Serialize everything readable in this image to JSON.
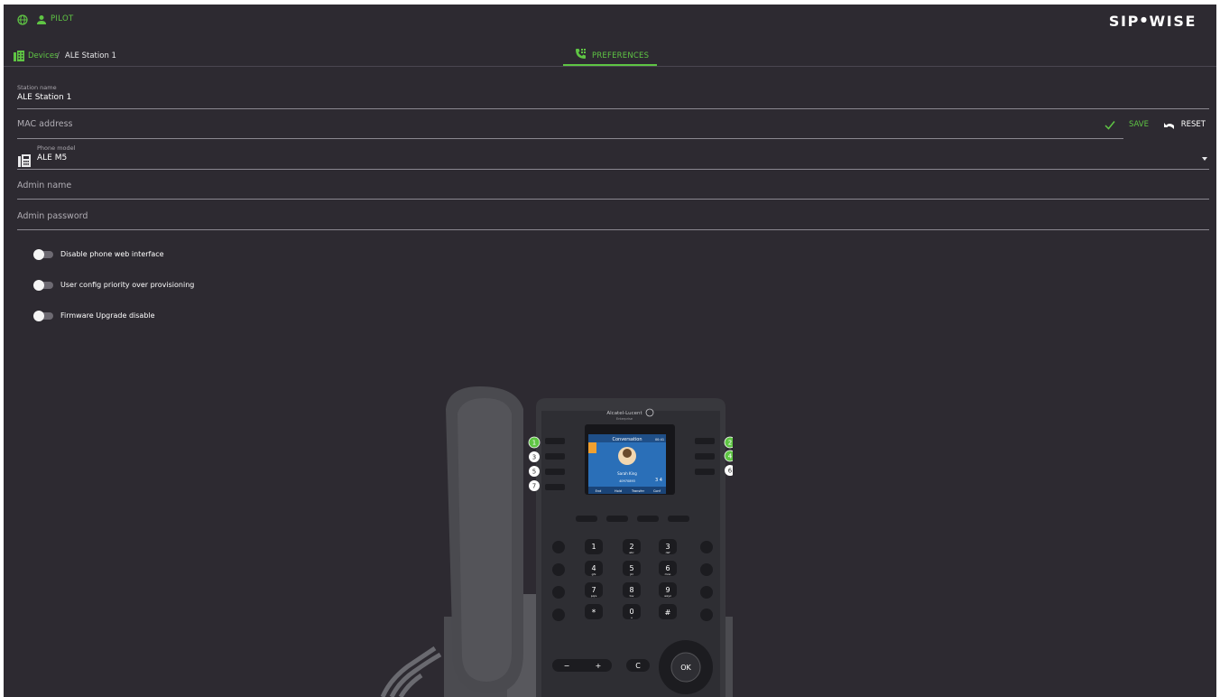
{
  "header": {
    "user_name": "PILOT",
    "logo_text_left": "SIP",
    "logo_text_right": "WISE",
    "logo_dot": "●"
  },
  "breadcrumb": {
    "link": "Devices",
    "separator": "/",
    "current": "ALE Station 1"
  },
  "tabs": [
    {
      "label": "PREFERENCES",
      "active": true
    }
  ],
  "form": {
    "station_name": {
      "label": "Station name",
      "value": "ALE Station 1"
    },
    "mac_address": {
      "placeholder": "MAC address"
    },
    "phone_model": {
      "label": "Phone model",
      "value": "ALE M5"
    },
    "admin_name": {
      "placeholder": "Admin name"
    },
    "admin_password": {
      "placeholder": "Admin password"
    }
  },
  "actions": {
    "save_label": "SAVE",
    "reset_label": "RESET"
  },
  "toggles": [
    {
      "label": "Disable phone web interface",
      "on": false
    },
    {
      "label": "User config priority over provisioning",
      "on": false
    },
    {
      "label": "Firmware Upgrade disable",
      "on": false
    }
  ],
  "phone_image": {
    "brand": "Alcatel-Lucent",
    "brand_sub": "Enterprise",
    "screen_title": "Conversation",
    "screen_time": "00:41",
    "contact_name": "Sarah King",
    "contact_number": "40970893",
    "page_indicator": "3 4",
    "softkeys": [
      "End",
      "Hold",
      "Transfer",
      "Conf"
    ],
    "line_key_numbers": [
      "1",
      "2",
      "3",
      "4",
      "5",
      "6",
      "7"
    ],
    "keypad": [
      {
        "digit": "1",
        "letters": ""
      },
      {
        "digit": "2",
        "letters": "abc"
      },
      {
        "digit": "3",
        "letters": "def"
      },
      {
        "digit": "4",
        "letters": "ghi"
      },
      {
        "digit": "5",
        "letters": "jkl"
      },
      {
        "digit": "6",
        "letters": "mno"
      },
      {
        "digit": "7",
        "letters": "pqrs"
      },
      {
        "digit": "8",
        "letters": "tuv"
      },
      {
        "digit": "9",
        "letters": "wxyz"
      },
      {
        "digit": "*",
        "letters": ""
      },
      {
        "digit": "0",
        "letters": "+"
      },
      {
        "digit": "#",
        "letters": ""
      }
    ],
    "ok_label": "OK",
    "minus_label": "−",
    "plus_label": "+",
    "clear_label": "C"
  },
  "colors": {
    "accent": "#5fc544",
    "background": "#2d2a31",
    "divider": "#8a8790"
  },
  "icons": {
    "globe": "globe-icon",
    "user": "user-icon",
    "breadcrumb": "building-icon",
    "tab": "phone-settings-icon",
    "save": "check-icon",
    "reset": "undo-icon",
    "phone_model": "phone-model-icon",
    "dropdown": "caret-down-icon"
  }
}
